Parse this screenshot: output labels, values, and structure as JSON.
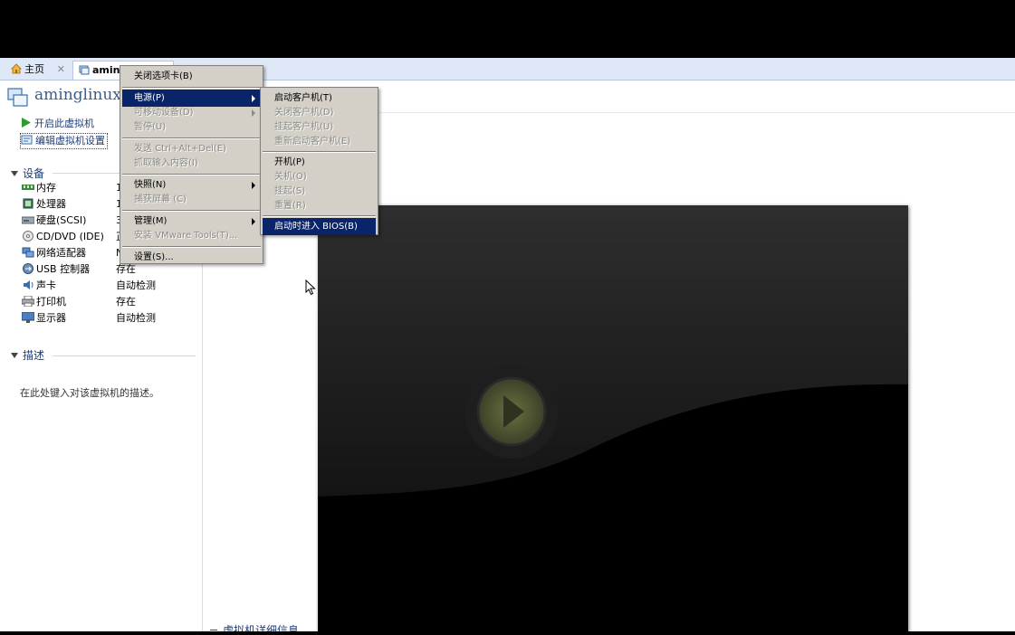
{
  "tabs": [
    {
      "label": "主页"
    },
    {
      "label": "amingl"
    }
  ],
  "vm": {
    "title": "aminglinux"
  },
  "actions": {
    "power_on": "开启此虚拟机",
    "edit_settings": "编辑虚拟机设置"
  },
  "devices": {
    "header": "设备",
    "items": [
      {
        "label": "内存",
        "value": "1"
      },
      {
        "label": "处理器",
        "value": "1"
      },
      {
        "label": "硬盘(SCSI)",
        "value": "3"
      },
      {
        "label": "CD/DVD (IDE)",
        "value": "正"
      },
      {
        "label": "网络适配器",
        "value": "N"
      },
      {
        "label": "USB 控制器",
        "value": "存在"
      },
      {
        "label": "声卡",
        "value": "自动检测"
      },
      {
        "label": "打印机",
        "value": "存在"
      },
      {
        "label": "显示器",
        "value": "自动检测"
      }
    ]
  },
  "description": {
    "header": "描述",
    "placeholder": "在此处键入对该虚拟机的描述。"
  },
  "details_header": "虚拟机详细信息",
  "context_menu": {
    "close_tab": "关闭选项卡(B)",
    "power": "电源(P)",
    "removable": "可移动设备(D)",
    "pause": "暂停(U)",
    "send_cad": "发送 Ctrl+Alt+Del(E)",
    "grab_input": "抓取输入内容(I)",
    "snapshot": "快照(N)",
    "capture_screen": "捕获屏幕 (C)",
    "manage": "管理(M)",
    "install_tools": "安装 VMware Tools(T)...",
    "settings": "设置(S)..."
  },
  "power_menu": {
    "start_guest": "启动客户机(T)",
    "shutdown_guest": "关闭客户机(D)",
    "suspend_guest": "挂起客户机(U)",
    "restart_guest": "重新启动客户机(E)",
    "power_on": "开机(P)",
    "power_off": "关机(O)",
    "suspend": "挂起(S)",
    "reset": "重置(R)",
    "boot_bios": "启动时进入 BIOS(B)"
  }
}
